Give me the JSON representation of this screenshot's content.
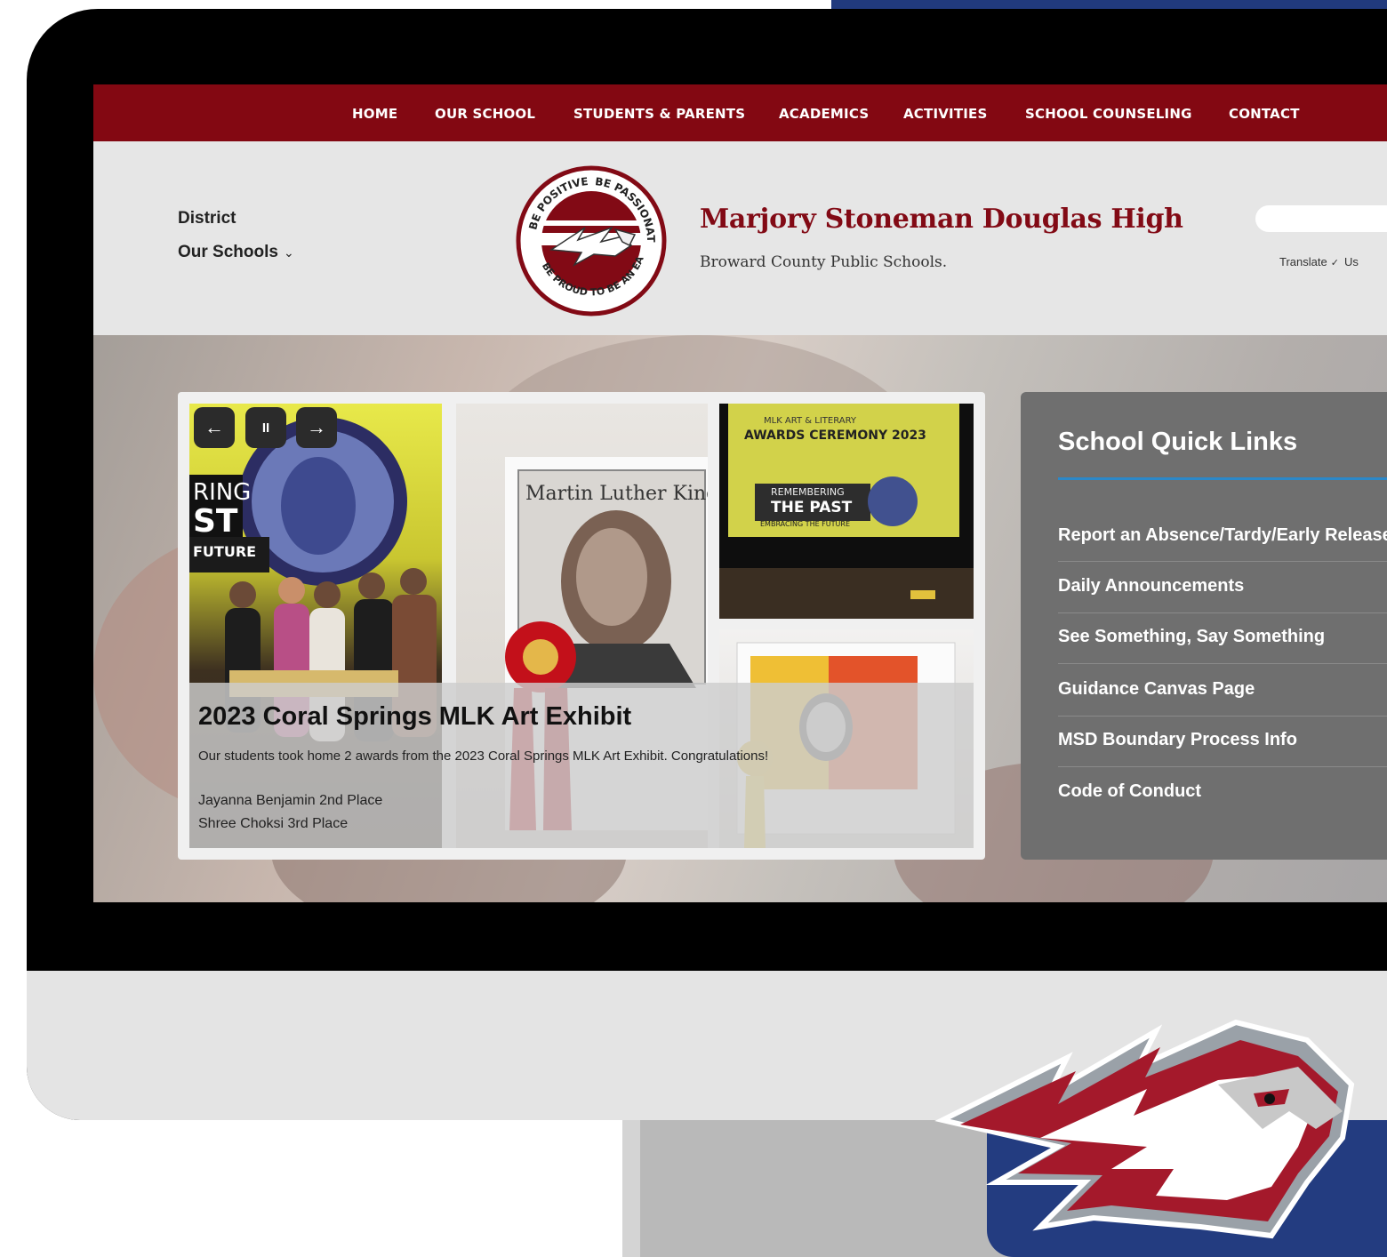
{
  "nav": {
    "items": [
      "HOME",
      "OUR SCHOOL",
      "STUDENTS & PARENTS",
      "ACADEMICS",
      "ACTIVITIES",
      "SCHOOL COUNSELING",
      "CONTACT"
    ]
  },
  "header": {
    "district": "District",
    "our_schools": "Our Schools",
    "school_name": "Marjory Stoneman Douglas High",
    "school_sub": "Broward County Public Schools.",
    "translate": "Translate",
    "translate_extra": "Us",
    "logo_text": [
      "BE POSITIVE",
      "BE PASSIONATE",
      "BE PROUD TO BE AN EAGLE"
    ]
  },
  "slide": {
    "title": "2023 Coral Springs MLK Art Exhibit",
    "text": "Our students took home 2 awards from the 2023 Coral Springs MLK Art Exhibit. Congratulations!",
    "line1": "Jayanna Benjamin 2nd Place",
    "line2": "Shree Choksi 3rd Place",
    "photo_text": {
      "p3_line1": "MLK ART & LITERARY",
      "p3_line2": "AWARDS CEREMONY 2023",
      "p3_line3": "REMEMBERING",
      "p3_line4": "THE PAST",
      "p3_line5": "EMBRACING THE FUTURE",
      "p2_art": "Martin Luther King Jr.",
      "p1_sign1": "RING",
      "p1_sign2": "ST",
      "p1_sign3": "FUTURE"
    }
  },
  "controls": {
    "prev": "←",
    "pause": "II",
    "next": "→"
  },
  "quick_links": {
    "title": "School Quick Links",
    "items": [
      "Report an Absence/Tardy/Early Release",
      "Daily Announcements",
      "See Something, Say Something",
      "Guidance Canvas Page",
      "MSD Boundary Process Info",
      "Code of Conduct"
    ]
  },
  "colors": {
    "nav": "#830812",
    "brand_red": "#820a15",
    "accent_blue": "#2b88c9",
    "panel": "#6f6f6f",
    "decor_blue": "#233c80"
  }
}
